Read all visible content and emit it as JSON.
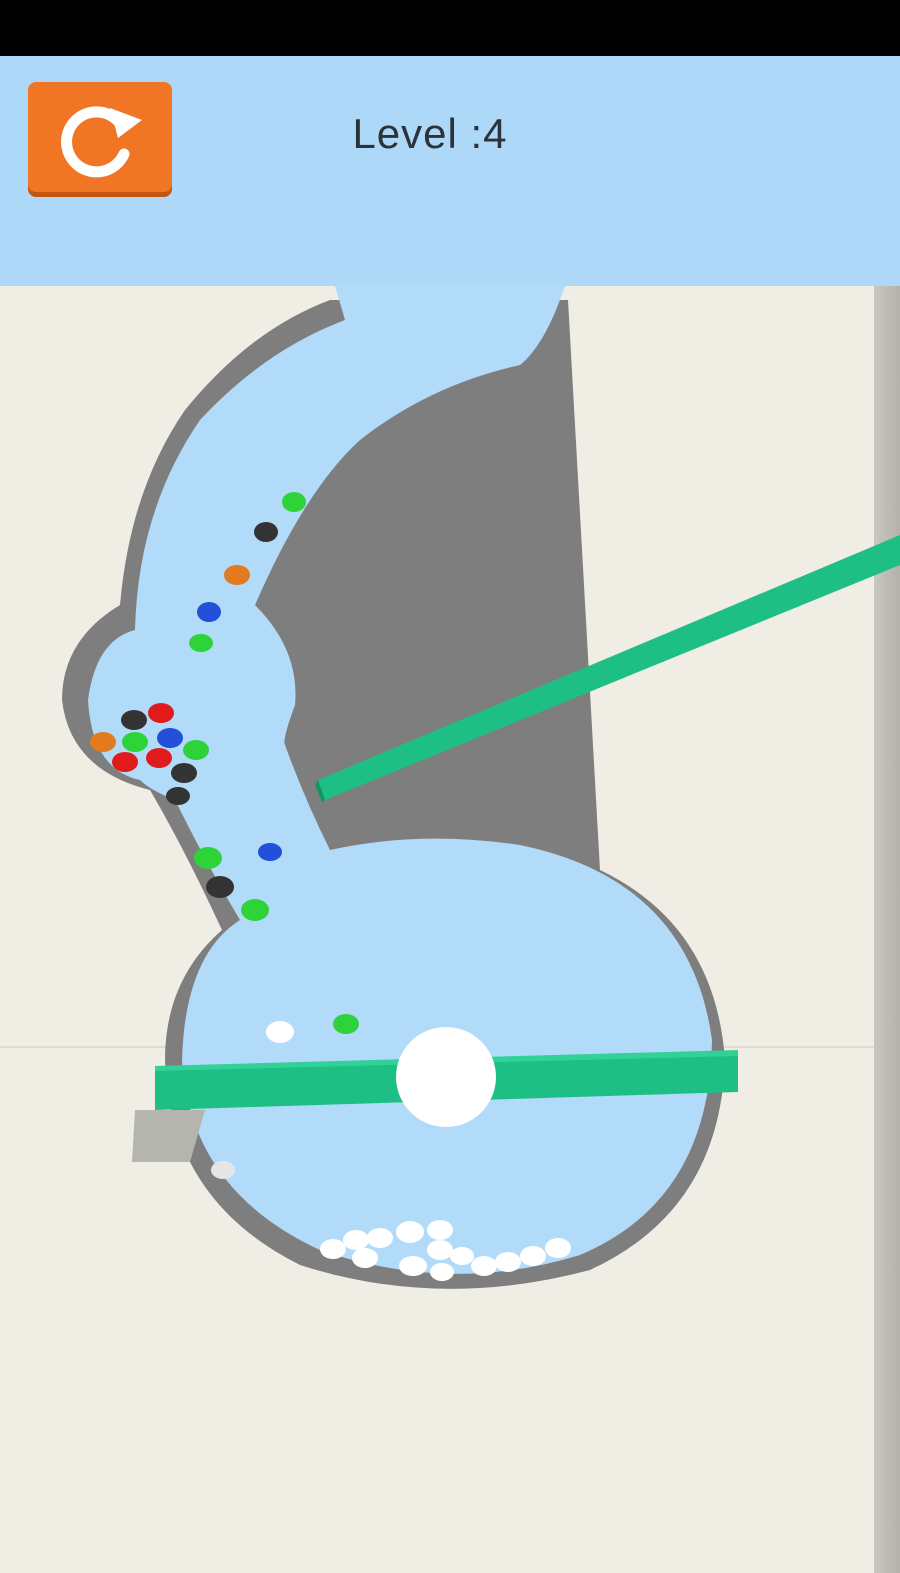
{
  "header": {
    "level_label": "Level :4",
    "restart_icon": "restart-arrow-icon"
  },
  "colors": {
    "sky": "#aed8f8",
    "floor": "#efede4",
    "water": "#b2dbfa",
    "wall": "#8a8a8a",
    "bar": "#1ebf85",
    "restart_button": "#f07625"
  },
  "balls": {
    "colors": [
      "green",
      "black",
      "orange",
      "blue",
      "red",
      "white"
    ]
  }
}
